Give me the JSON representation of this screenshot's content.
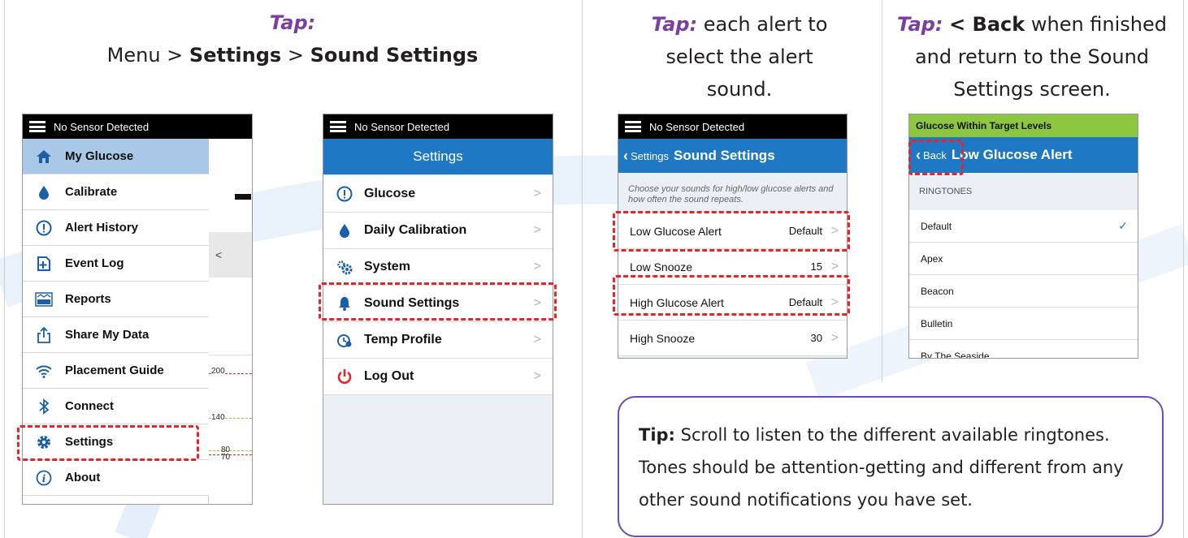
{
  "col1": {
    "tap": "Tap:",
    "path_menu": "Menu > ",
    "path_settings": "Settings",
    "path_sep": " > ",
    "path_sound": "Sound Settings"
  },
  "col2": {
    "tap": "Tap:",
    "line1": " each alert to",
    "line2": "select the alert",
    "line3": "sound."
  },
  "col3": {
    "tap": "Tap:",
    "back": "< Back",
    "line1": " when finished",
    "line2": "and return to the Sound",
    "line3": "Settings screen."
  },
  "screen_menu": {
    "status": "No Sensor Detected",
    "items": [
      {
        "label": "My Glucose",
        "icon": "home-icon"
      },
      {
        "label": "Calibrate",
        "icon": "drop-icon"
      },
      {
        "label": "Alert History",
        "icon": "alert-icon"
      },
      {
        "label": "Event Log",
        "icon": "event-log-icon"
      },
      {
        "label": "Reports",
        "icon": "reports-icon"
      },
      {
        "label": "Share My Data",
        "icon": "share-icon"
      },
      {
        "label": "Placement Guide",
        "icon": "wifi-icon"
      },
      {
        "label": "Connect",
        "icon": "bluetooth-icon"
      },
      {
        "label": "Settings",
        "icon": "gear-icon"
      },
      {
        "label": "About",
        "icon": "info-icon"
      }
    ],
    "graph_labels": [
      "200",
      "140",
      "80",
      "70"
    ],
    "back_glyph": "<"
  },
  "screen_settings": {
    "status": "No Sensor Detected",
    "title": "Settings",
    "items": [
      {
        "label": "Glucose",
        "icon": "alert-icon"
      },
      {
        "label": "Daily Calibration",
        "icon": "drop-icon"
      },
      {
        "label": "System",
        "icon": "gears-icon"
      },
      {
        "label": "Sound Settings",
        "icon": "bell-icon"
      },
      {
        "label": "Temp Profile",
        "icon": "temp-profile-icon"
      },
      {
        "label": "Log Out",
        "icon": "power-icon"
      }
    ]
  },
  "screen_sound": {
    "status": "No Sensor Detected",
    "back": "Settings",
    "title": "Sound Settings",
    "hint": "Choose your sounds for high/low glucose alerts and how often the sound repeats.",
    "rows": [
      {
        "label": "Low Glucose Alert",
        "value": "Default"
      },
      {
        "label": "Low Snooze",
        "value": "15"
      },
      {
        "label": "High Glucose Alert",
        "value": "Default"
      },
      {
        "label": "High Snooze",
        "value": "30"
      }
    ]
  },
  "screen_ringtone": {
    "banner": "Glucose Within Target Levels",
    "back": "Back",
    "title": "Low Glucose Alert",
    "section": "RINGTONES",
    "tones": [
      "Default",
      "Apex",
      "Beacon",
      "Bulletin",
      "By The Seaside"
    ],
    "selected_index": 0
  },
  "tip": {
    "label": "Tip:",
    "text": " Scroll to listen to the different available ringtones. Tones should be attention-getting and different from any other sound notifications you have set."
  },
  "colors": {
    "tap_purple": "#7a3fa0",
    "header_blue": "#1f78c3",
    "highlight_red": "#e3262b",
    "banner_green": "#8dc63f",
    "menu_active": "#a9c8e8"
  }
}
